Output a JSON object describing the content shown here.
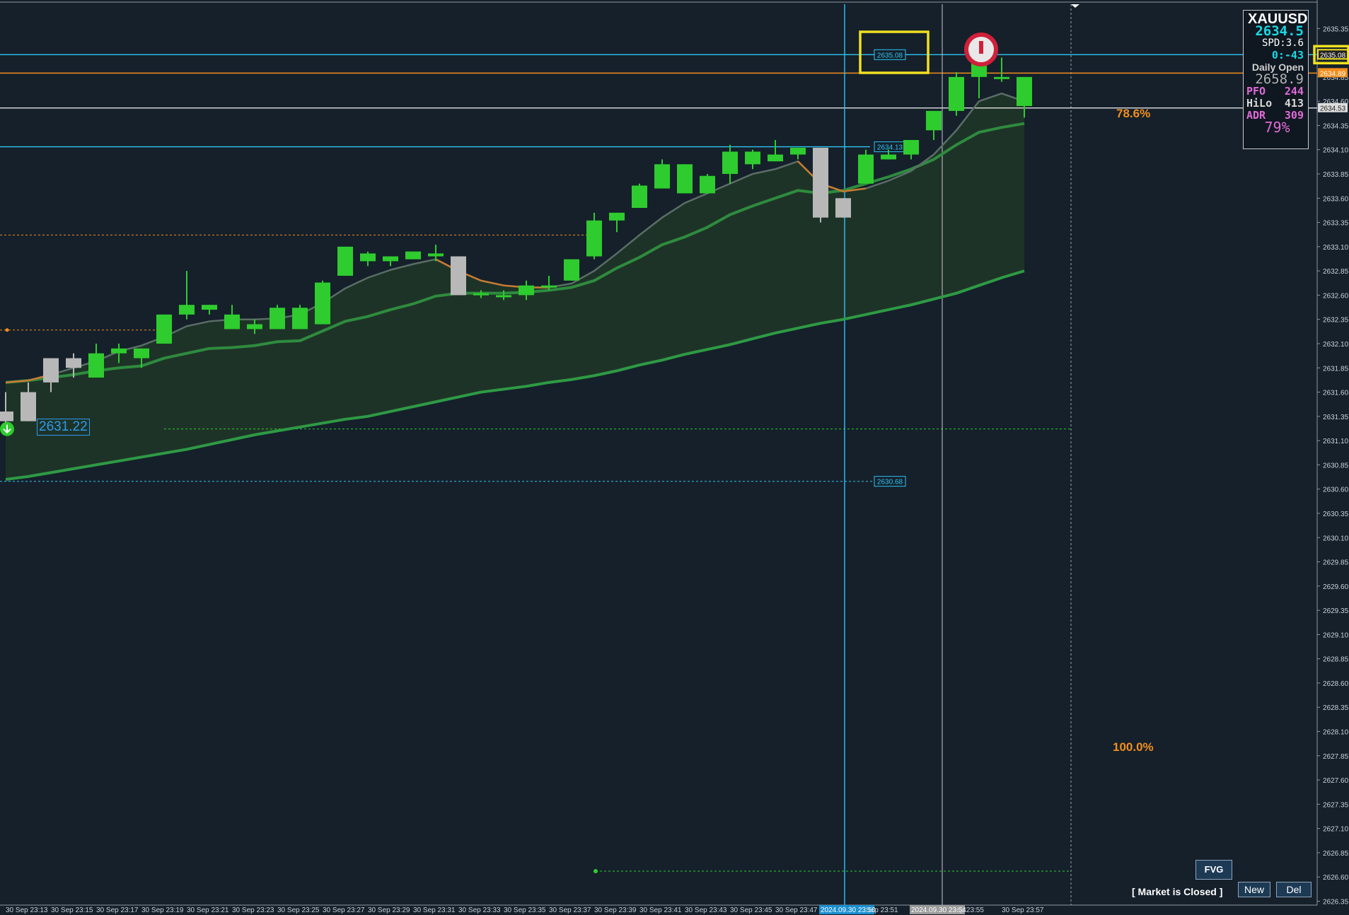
{
  "chart_data": {
    "type": "candlestick",
    "symbol": "XAUUSD",
    "price_axis": {
      "ticks": [
        "2635.35",
        "2635.10",
        "2634.85",
        "2634.60",
        "2634.35",
        "2634.10",
        "2633.85",
        "2633.60",
        "2633.35",
        "2633.10",
        "2632.85",
        "2632.60",
        "2632.35",
        "2632.10",
        "2631.85",
        "2631.60",
        "2631.35",
        "2631.10",
        "2630.85",
        "2630.60",
        "2630.35",
        "2630.10",
        "2629.85",
        "2629.60",
        "2629.35",
        "2629.10",
        "2628.85",
        "2628.60",
        "2628.35",
        "2628.10",
        "2627.85",
        "2627.60",
        "2627.35",
        "2627.10",
        "2626.85",
        "2626.60",
        "2626.35"
      ],
      "range": [
        2626.31,
        2635.6
      ],
      "markers": [
        {
          "text": "2635.08",
          "price": 2635.08,
          "color": "#222222"
        },
        {
          "text": "2634.89",
          "price": 2634.89,
          "color": "#f28e1c"
        },
        {
          "text": "2634.53",
          "price": 2634.53,
          "color": "#dddddd"
        }
      ]
    },
    "time_labels": [
      "30 Sep 23:13",
      "30 Sep 23:15",
      "30 Sep 23:17",
      "30 Sep 23:19",
      "30 Sep 23:21",
      "30 Sep 23:23",
      "30 Sep 23:25",
      "30 Sep 23:27",
      "30 Sep 23:29",
      "30 Sep 23:31",
      "30 Sep 23:33",
      "30 Sep 23:35",
      "30 Sep 23:37",
      "30 Sep 23:39",
      "30 Sep 23:41",
      "30 Sep 23:43",
      "30 Sep 23:45",
      "30 Sep 23:47",
      "2024.09.30 23:50",
      "Sep 23:51",
      "2024.09.30 23:54",
      "ep 23:55",
      "30 Sep 23:57"
    ],
    "candles": [
      {
        "o": 2631.4,
        "h": 2631.6,
        "l": 2631.25,
        "c": 2631.3
      },
      {
        "o": 2631.6,
        "h": 2631.7,
        "l": 2631.3,
        "c": 2631.3
      },
      {
        "o": 2631.95,
        "h": 2631.95,
        "l": 2631.6,
        "c": 2631.7
      },
      {
        "o": 2631.95,
        "h": 2632.0,
        "l": 2631.75,
        "c": 2631.85
      },
      {
        "o": 2631.75,
        "h": 2632.1,
        "l": 2631.75,
        "c": 2632.0
      },
      {
        "o": 2632.0,
        "h": 2632.1,
        "l": 2631.9,
        "c": 2632.05
      },
      {
        "o": 2631.95,
        "h": 2632.05,
        "l": 2631.85,
        "c": 2632.05
      },
      {
        "o": 2632.1,
        "h": 2632.4,
        "l": 2632.1,
        "c": 2632.4
      },
      {
        "o": 2632.4,
        "h": 2632.85,
        "l": 2632.35,
        "c": 2632.5
      },
      {
        "o": 2632.45,
        "h": 2632.5,
        "l": 2632.4,
        "c": 2632.5
      },
      {
        "o": 2632.25,
        "h": 2632.5,
        "l": 2632.25,
        "c": 2632.4
      },
      {
        "o": 2632.25,
        "h": 2632.35,
        "l": 2632.2,
        "c": 2632.3
      },
      {
        "o": 2632.25,
        "h": 2632.5,
        "l": 2632.25,
        "c": 2632.47
      },
      {
        "o": 2632.25,
        "h": 2632.5,
        "l": 2632.25,
        "c": 2632.47
      },
      {
        "o": 2632.3,
        "h": 2632.75,
        "l": 2632.3,
        "c": 2632.73
      },
      {
        "o": 2632.8,
        "h": 2633.1,
        "l": 2632.8,
        "c": 2633.1
      },
      {
        "o": 2632.95,
        "h": 2633.05,
        "l": 2632.9,
        "c": 2633.03
      },
      {
        "o": 2632.95,
        "h": 2633.0,
        "l": 2632.9,
        "c": 2633.0
      },
      {
        "o": 2632.97,
        "h": 2633.05,
        "l": 2632.97,
        "c": 2633.05
      },
      {
        "o": 2633.0,
        "h": 2633.12,
        "l": 2632.95,
        "c": 2633.03
      },
      {
        "o": 2633.0,
        "h": 2633.0,
        "l": 2632.6,
        "c": 2632.6
      },
      {
        "o": 2632.6,
        "h": 2632.65,
        "l": 2632.57,
        "c": 2632.62
      },
      {
        "o": 2632.6,
        "h": 2632.65,
        "l": 2632.55,
        "c": 2632.6
      },
      {
        "o": 2632.6,
        "h": 2632.75,
        "l": 2632.55,
        "c": 2632.7
      },
      {
        "o": 2632.7,
        "h": 2632.8,
        "l": 2632.65,
        "c": 2632.7
      },
      {
        "o": 2632.75,
        "h": 2632.95,
        "l": 2632.75,
        "c": 2632.97
      },
      {
        "o": 2633.0,
        "h": 2633.45,
        "l": 2632.97,
        "c": 2633.37
      },
      {
        "o": 2633.37,
        "h": 2633.45,
        "l": 2633.25,
        "c": 2633.45
      },
      {
        "o": 2633.5,
        "h": 2633.75,
        "l": 2633.5,
        "c": 2633.73
      },
      {
        "o": 2633.7,
        "h": 2634.0,
        "l": 2633.7,
        "c": 2633.95
      },
      {
        "o": 2633.65,
        "h": 2633.95,
        "l": 2633.65,
        "c": 2633.95
      },
      {
        "o": 2633.65,
        "h": 2633.85,
        "l": 2633.65,
        "c": 2633.83
      },
      {
        "o": 2633.85,
        "h": 2634.15,
        "l": 2633.75,
        "c": 2634.08
      },
      {
        "o": 2633.95,
        "h": 2634.1,
        "l": 2633.9,
        "c": 2634.08
      },
      {
        "o": 2633.98,
        "h": 2634.2,
        "l": 2633.98,
        "c": 2634.05
      },
      {
        "o": 2634.05,
        "h": 2634.12,
        "l": 2634.0,
        "c": 2634.12
      },
      {
        "o": 2634.12,
        "h": 2634.12,
        "l": 2633.35,
        "c": 2633.4
      },
      {
        "o": 2633.6,
        "h": 2633.6,
        "l": 2633.4,
        "c": 2633.4
      },
      {
        "o": 2633.75,
        "h": 2634.1,
        "l": 2633.75,
        "c": 2634.05
      },
      {
        "o": 2634.0,
        "h": 2634.1,
        "l": 2634.0,
        "c": 2634.05
      },
      {
        "o": 2634.05,
        "h": 2634.2,
        "l": 2634.0,
        "c": 2634.2
      },
      {
        "o": 2634.3,
        "h": 2634.5,
        "l": 2634.2,
        "c": 2634.5
      },
      {
        "o": 2634.5,
        "h": 2634.9,
        "l": 2634.45,
        "c": 2634.85
      },
      {
        "o": 2634.85,
        "h": 2635.08,
        "l": 2634.63,
        "c": 2635.05
      },
      {
        "o": 2634.85,
        "h": 2635.05,
        "l": 2634.8,
        "c": 2634.85
      },
      {
        "o": 2634.55,
        "h": 2634.85,
        "l": 2634.43,
        "c": 2634.85
      }
    ],
    "ema_fast": [
      2631.7,
      2631.72,
      2631.78,
      2631.85,
      2631.92,
      2632.02,
      2632.08,
      2632.17,
      2632.28,
      2632.33,
      2632.35,
      2632.35,
      2632.36,
      2632.4,
      2632.52,
      2632.67,
      2632.78,
      2632.86,
      2632.92,
      2632.97,
      2632.85,
      2632.75,
      2632.7,
      2632.68,
      2632.68,
      2632.72,
      2632.85,
      2633.03,
      2633.22,
      2633.4,
      2633.55,
      2633.65,
      2633.75,
      2633.85,
      2633.9,
      2633.98,
      2633.75,
      2633.67,
      2633.7,
      2633.78,
      2633.88,
      2634.05,
      2634.3,
      2634.6,
      2634.68,
      2634.6
    ],
    "ema_mid": [
      2631.7,
      2631.72,
      2631.75,
      2631.78,
      2631.82,
      2631.85,
      2631.87,
      2631.95,
      2632.0,
      2632.05,
      2632.06,
      2632.08,
      2632.12,
      2632.13,
      2632.23,
      2632.33,
      2632.38,
      2632.45,
      2632.51,
      2632.59,
      2632.62,
      2632.62,
      2632.62,
      2632.63,
      2632.65,
      2632.68,
      2632.75,
      2632.88,
      2632.99,
      2633.12,
      2633.2,
      2633.3,
      2633.43,
      2633.52,
      2633.6,
      2633.68,
      2633.65,
      2633.68,
      2633.75,
      2633.82,
      2633.9,
      2634.0,
      2634.15,
      2634.28,
      2634.33,
      2634.37
    ],
    "ema_slow": [
      2630.7,
      2630.73,
      2630.77,
      2630.81,
      2630.85,
      2630.89,
      2630.93,
      2630.97,
      2631.01,
      2631.06,
      2631.11,
      2631.16,
      2631.2,
      2631.24,
      2631.28,
      2631.32,
      2631.35,
      2631.4,
      2631.45,
      2631.5,
      2631.55,
      2631.6,
      2631.63,
      2631.66,
      2631.7,
      2631.73,
      2631.77,
      2631.82,
      2631.88,
      2631.93,
      2631.99,
      2632.04,
      2632.09,
      2632.15,
      2632.21,
      2632.26,
      2632.31,
      2632.35,
      2632.4,
      2632.45,
      2632.5,
      2632.56,
      2632.62,
      2632.7,
      2632.78,
      2632.85
    ],
    "levels": [
      {
        "label": "2635.08",
        "price": 2635.08,
        "color": "#2ec4f2"
      },
      {
        "label": "",
        "price": 2634.89,
        "color": "#f28e1c"
      },
      {
        "label": "",
        "price": 2634.53,
        "color": "#e0e0e0"
      },
      {
        "label": "2634.13",
        "price": 2634.13,
        "color": "#2ec4f2"
      },
      {
        "label": "2630.68",
        "price": 2630.68,
        "color": "#2ec4f2"
      }
    ],
    "fib_levels": [
      {
        "label": "78.6%",
        "price": 2634.53
      },
      {
        "label": "100.0%",
        "price": 2627.92
      }
    ]
  },
  "panel": {
    "symbol": "XAUUSD",
    "price": "2634.5",
    "spread": "SPD:3.6",
    "timer": "0:-43",
    "daily_open_label": "Daily Open",
    "daily_open_value": "2658.9",
    "pfo_label": "PFO",
    "pfo_value": "244",
    "hilo_label": "HiLo",
    "hilo_value": "413",
    "adr_label": "ADR",
    "adr_value": "309",
    "adr_pct": "79%"
  },
  "price_tag": "2631.22",
  "buttons": {
    "fvg": "FVG",
    "new": "New",
    "del": "Del"
  },
  "status": "[ Market is Closed ]",
  "colors": {
    "background": "#15202b",
    "bull": "#2ecc2e",
    "bear": "#b8b8b8",
    "ema_fast": "#5a6d66",
    "ema_mid": "#2e8b3e",
    "cloud": "#1f3527",
    "fib": "#f28e1c",
    "level": "#2ec4f2",
    "highlight": "#f0e020"
  }
}
